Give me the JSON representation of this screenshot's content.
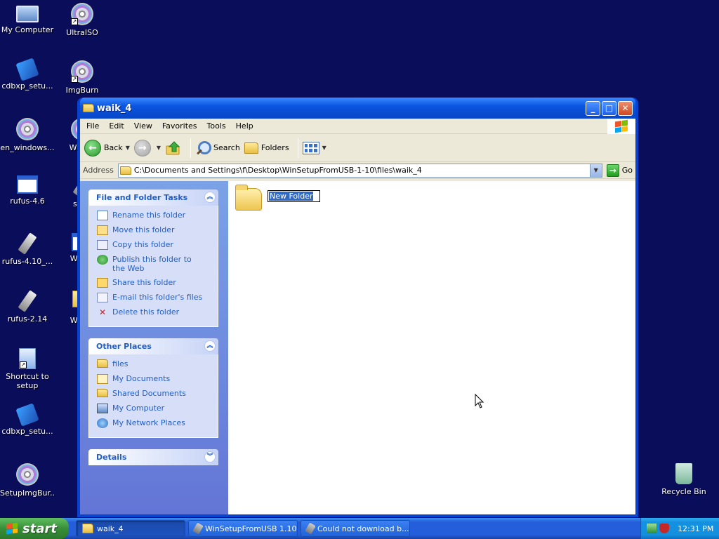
{
  "desktop": {
    "icons": [
      {
        "label": "My Computer"
      },
      {
        "label": "UltraISO"
      },
      {
        "label": "cdbxp_setu..."
      },
      {
        "label": "ImgBurn"
      },
      {
        "label": "en_windows..."
      },
      {
        "label": "WinCD"
      },
      {
        "label": "rufus-4.6"
      },
      {
        "label": "scari"
      },
      {
        "label": "rufus-4.10_..."
      },
      {
        "label": "WinSe"
      },
      {
        "label": "rufus-2.14"
      },
      {
        "label": "WinSe"
      },
      {
        "label": "Shortcut to setup"
      },
      {
        "label": "cdbxp_setu..."
      },
      {
        "label": "SetupImgBur..."
      },
      {
        "label": "Recycle Bin"
      }
    ]
  },
  "window": {
    "title": "waik_4",
    "buttons": {
      "minimize": "_",
      "maximize": "□",
      "close": "✕"
    },
    "menu": [
      "File",
      "Edit",
      "View",
      "Favorites",
      "Tools",
      "Help"
    ],
    "toolbar": {
      "back": "Back",
      "search": "Search",
      "folders": "Folders"
    },
    "address": {
      "label": "Address",
      "value": "C:\\Documents and Settings\\f\\Desktop\\WinSetupFromUSB-1-10\\files\\waik_4",
      "go": "Go"
    },
    "file_tasks": {
      "title": "File and Folder Tasks",
      "items": [
        {
          "label": "Rename this folder",
          "icon": "rename-icon"
        },
        {
          "label": "Move this folder",
          "icon": "move-icon"
        },
        {
          "label": "Copy this folder",
          "icon": "copy-icon"
        },
        {
          "label": "Publish this folder to the Web",
          "icon": "publish-icon"
        },
        {
          "label": "Share this folder",
          "icon": "share-icon"
        },
        {
          "label": "E-mail this folder's files",
          "icon": "email-icon"
        },
        {
          "label": "Delete this folder",
          "icon": "delete-icon"
        }
      ]
    },
    "other_places": {
      "title": "Other Places",
      "items": [
        {
          "label": "files"
        },
        {
          "label": "My Documents"
        },
        {
          "label": "Shared Documents"
        },
        {
          "label": "My Computer"
        },
        {
          "label": "My Network Places"
        }
      ]
    },
    "details": {
      "title": "Details"
    },
    "content": {
      "new_folder_name": "New Folder"
    }
  },
  "taskbar": {
    "start": "start",
    "tasks": [
      {
        "label": "waik_4",
        "active": true
      },
      {
        "label": "WinSetupFromUSB 1.10",
        "active": false
      },
      {
        "label": "Could not download b...",
        "active": false
      }
    ],
    "clock": "12:31 PM"
  }
}
